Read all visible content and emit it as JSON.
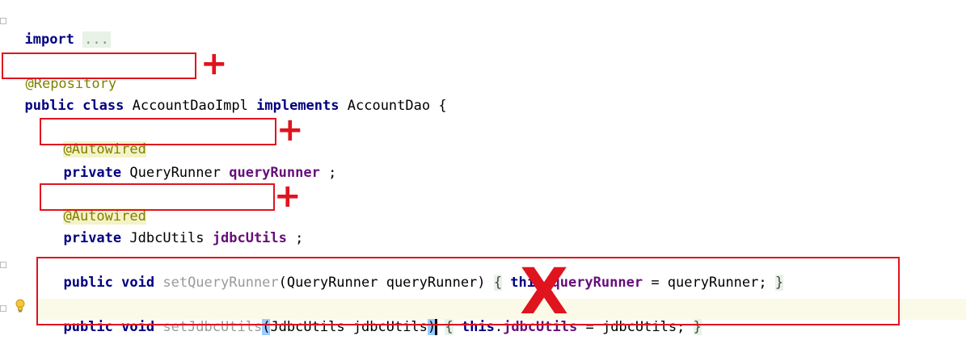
{
  "code": {
    "import_kw": "import",
    "import_fold": "...",
    "repository": "@Repository",
    "class_public": "public",
    "class_kw": "class",
    "class_name": "AccountDaoImpl",
    "implements_kw": "implements",
    "interface_name": "AccountDao",
    "open_brace": "{",
    "autowired_1": "@Autowired",
    "private_1": "private",
    "type_1": "QueryRunner",
    "field_1": "queryRunner",
    "semi_1": ";",
    "autowired_2": "@Autowired",
    "private_2": "private",
    "type_2": "JdbcUtils",
    "field_2": "jdbcUtils",
    "semi_2": ";",
    "m1_public": "public",
    "m1_void": "void",
    "m1_name": "setQueryRunner",
    "m1_params": "(QueryRunner queryRunner)",
    "m1_open": "{",
    "m1_this": "this",
    "m1_field": "queryRunner",
    "m1_assign": "= queryRunner;",
    "m1_close": "}",
    "m2_public": "public",
    "m2_void": "void",
    "m2_name": "setJdbcUtils",
    "m2_paren_open": "(",
    "m2_params": "JdbcUtils jdbcUtils",
    "m2_paren_close": ")",
    "m2_open": "{",
    "m2_this": "this",
    "m2_field": "jdbcUtils",
    "m2_assign": "= jdbcUtils;",
    "m2_close": "}"
  },
  "annotations": {
    "plus_mark": "+",
    "x_mark": "X",
    "accent_color": "#e0141e"
  }
}
